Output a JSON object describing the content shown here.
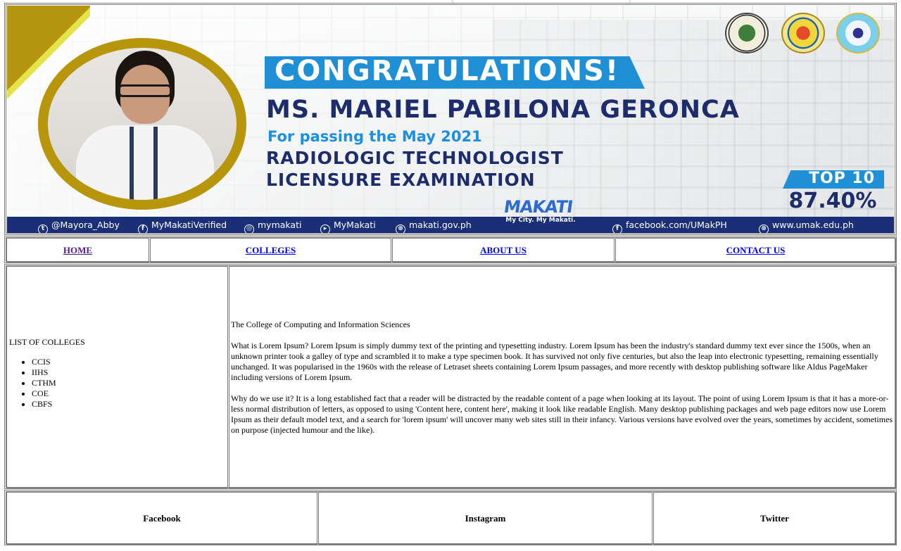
{
  "banner": {
    "headline": "CONGRATULATIONS!",
    "honoree": "MS. MARIEL PABILONA GERONCA",
    "subline": "For passing the May 2021",
    "exam_line_1": "RADIOLOGIC TECHNOLOGIST",
    "exam_line_2": "LICENSURE EXAMINATION",
    "rank": "TOP 10",
    "score": "87.40%",
    "makati_logo": "MAKATI",
    "makati_slogan": "My City. My Makati.",
    "social": [
      {
        "icon": "twitter-icon",
        "label": "@Mayora_Abby"
      },
      {
        "icon": "facebook-icon",
        "label": "MyMakatiVerified"
      },
      {
        "icon": "instagram-icon",
        "label": "mymakati"
      },
      {
        "icon": "youtube-icon",
        "label": "MyMakati"
      },
      {
        "icon": "globe-icon",
        "label": "makati.gov.ph"
      },
      {
        "icon": "facebook-icon",
        "label": "facebook.com/UMakPH"
      },
      {
        "icon": "globe-icon",
        "label": "www.umak.edu.ph"
      }
    ],
    "colors": {
      "blue": "#1f8fd6",
      "navy": "#1d2d6b",
      "gold": "#b8960c",
      "strip": "#1b2e78"
    }
  },
  "nav": {
    "home": "HOME",
    "colleges": "COLLEGES",
    "about": "ABOUT US",
    "contact": "CONTACT US"
  },
  "sidebar": {
    "title": "LIST OF COLLEGES",
    "items": [
      "CCIS",
      "IIHS",
      "CTHM",
      "COE",
      "CBFS"
    ]
  },
  "main": {
    "heading": "The College of Computing and Information Sciences",
    "para1": "What is Lorem Ipsum? Lorem Ipsum is simply dummy text of the printing and typesetting industry. Lorem Ipsum has been the industry's standard dummy text ever since the 1500s, when an unknown printer took a galley of type and scrambled it to make a type specimen book. It has survived not only five centuries, but also the leap into electronic typesetting, remaining essentially unchanged. It was popularised in the 1960s with the release of Letraset sheets containing Lorem Ipsum passages, and more recently with desktop publishing software like Aldus PageMaker including versions of Lorem Ipsum.",
    "para2": "Why do we use it? It is a long established fact that a reader will be distracted by the readable content of a page when looking at its layout. The point of using Lorem Ipsum is that it has a more-or-less normal distribution of letters, as opposed to using 'Content here, content here', making it look like readable English. Many desktop publishing packages and web page editors now use Lorem Ipsum as their default model text, and a search for 'lorem ipsum' will uncover many web sites still in their infancy. Various versions have evolved over the years, sometimes by accident, sometimes on purpose (injected humour and the like)."
  },
  "footer": {
    "facebook": "Facebook",
    "instagram": "Instagram",
    "twitter": "Twitter"
  }
}
